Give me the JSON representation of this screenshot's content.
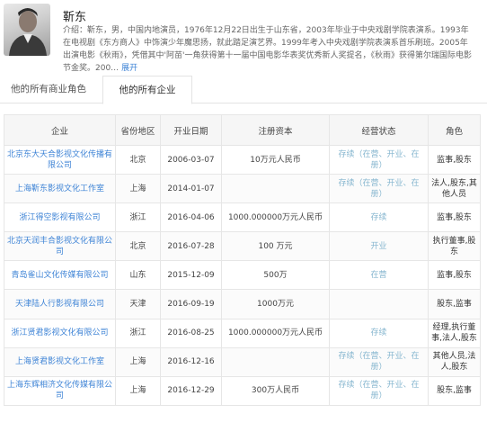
{
  "profile": {
    "name": "靳东",
    "bio": "介绍：靳东，男，中国内地演员，1976年12月22日出生于山东省，2003年毕业于中央戏剧学院表演系。1993年在电视剧《东方商人》中饰演少年魔思扬，就此踏足演艺界。1999年考入中央戏剧学院表演系首乐刷班。2005年出演电影《秋雨》，凭借其中'阿苗'一角获得第十一届中国电影华表奖优秀新人奖提名，《秋雨》获得第尔瑞国际电影节金奖。200…",
    "more_label": "展开"
  },
  "tabs": [
    {
      "label": "他的所有商业角色",
      "active": false
    },
    {
      "label": "他的所有企业",
      "active": true
    }
  ],
  "table": {
    "headers": [
      "企业",
      "省份地区",
      "开业日期",
      "注册资本",
      "经营状态",
      "角色"
    ],
    "rows": [
      {
        "company": "北京东大天合影视文化传播有限公司",
        "region": "北京",
        "date": "2006-03-07",
        "capital": "10万元人民币",
        "status": "存续（在营、开业、在册）",
        "role": "监事,股东"
      },
      {
        "company": "上海靳东影视文化工作室",
        "region": "上海",
        "date": "2014-01-07",
        "capital": "",
        "status": "存续（在营、开业、在册）",
        "role": "法人,股东,其他人员"
      },
      {
        "company": "浙江得空影视有限公司",
        "region": "浙江",
        "date": "2016-04-06",
        "capital": "1000.000000万元人民币",
        "status": "存续",
        "role": "监事,股东"
      },
      {
        "company": "北京天润丰合影视文化有限公司",
        "region": "北京",
        "date": "2016-07-28",
        "capital": "100 万元",
        "status": "开业",
        "role": "执行董事,股东"
      },
      {
        "company": "青岛雀山文化传媒有限公司",
        "region": "山东",
        "date": "2015-12-09",
        "capital": "500万",
        "status": "在营",
        "role": "监事,股东"
      },
      {
        "company": "天津陆人行影视有限公司",
        "region": "天津",
        "date": "2016-09-19",
        "capital": "1000万元",
        "status": "",
        "role": "股东,监事"
      },
      {
        "company": "浙江贤君影视文化有限公司",
        "region": "浙江",
        "date": "2016-08-25",
        "capital": "1000.000000万元人民币",
        "status": "存续",
        "role": "经理,执行董事,法人,股东"
      },
      {
        "company": "上海贤君影视文化工作室",
        "region": "上海",
        "date": "2016-12-16",
        "capital": "",
        "status": "存续（在营、开业、在册）",
        "role": "其他人员,法人,股东"
      },
      {
        "company": "上海东辉相济文化传媒有限公司",
        "region": "上海",
        "date": "2016-12-29",
        "capital": "300万人民币",
        "status": "存续（在营、开业、在册）",
        "role": "股东,监事"
      }
    ]
  },
  "colors": {
    "link": "#3f84d6",
    "status": "#86b6cf",
    "header_bg": "#f6f6f6",
    "border": "#e6e6e6"
  }
}
